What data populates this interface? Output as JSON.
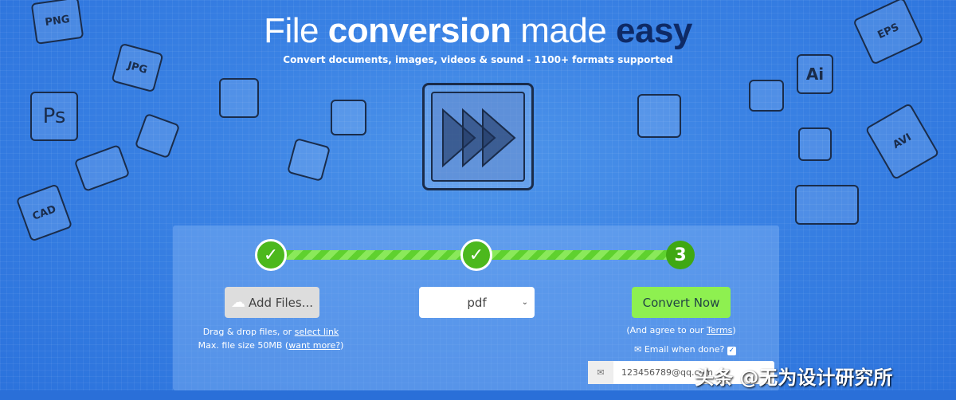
{
  "header": {
    "title_part1": "File",
    "title_part2": "conversion",
    "title_part3": "made",
    "title_part4": "easy",
    "subtitle": "Convert documents, images, videos & sound - 1100+ formats supported"
  },
  "decor_labels": [
    "PNG",
    "JPG",
    "Ps",
    "CAD",
    "EPS",
    "Ai",
    "AVI"
  ],
  "steps": [
    {
      "label": "✓",
      "done": true
    },
    {
      "label": "✓",
      "done": true
    },
    {
      "label": "3",
      "done": false
    }
  ],
  "add_files": {
    "label": "Add Files...",
    "icon": "cloud-upload-icon",
    "hint_prefix": "Drag & drop files, or ",
    "hint_link": "select link",
    "size_prefix": "Max. file size 50MB (",
    "size_link": "want more?",
    "size_suffix": ")"
  },
  "format_select": {
    "value": "pdf"
  },
  "convert": {
    "label": "Convert Now",
    "terms_prefix": "(And agree to our ",
    "terms_link": "Terms",
    "terms_suffix": ")",
    "email_label": "Email when done?",
    "email_checked": true,
    "email_value": "123456789@qq.com"
  },
  "watermark": "头条 @无为设计研究所",
  "colors": {
    "background": "#3a82e4",
    "accent_green": "#8ef050",
    "title_dark": "#0e2a66"
  }
}
